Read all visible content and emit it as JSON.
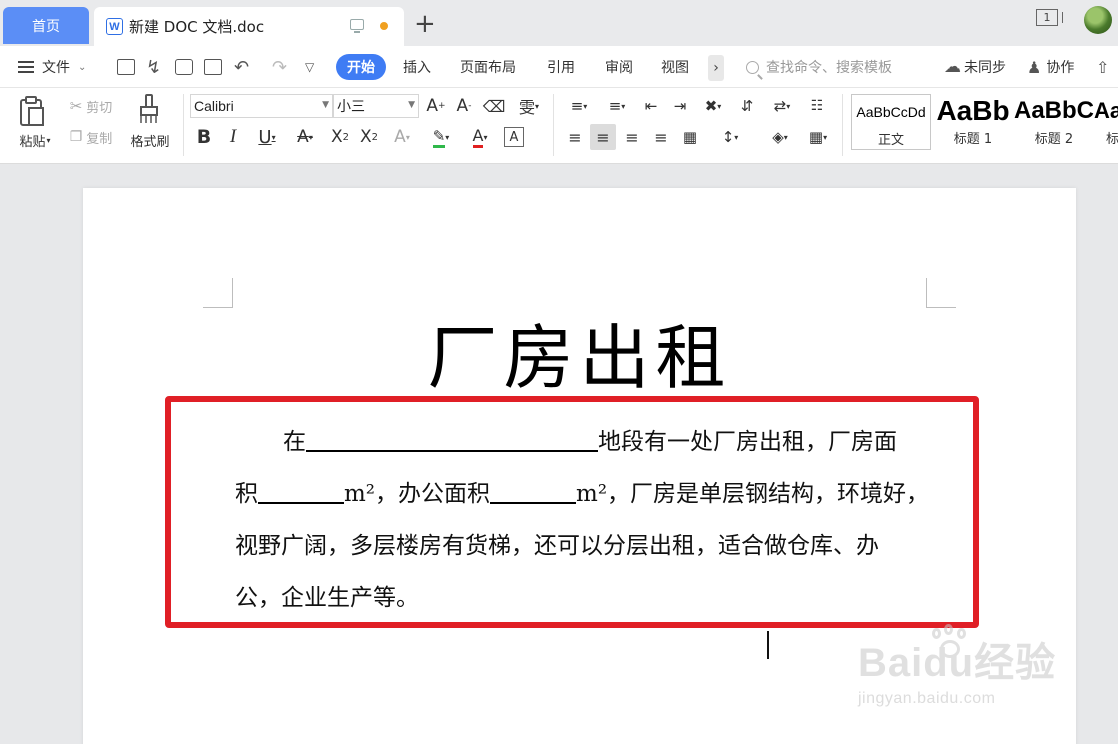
{
  "tabs": {
    "home_label": "首页",
    "doc_title": "新建 DOC 文档.doc",
    "window_count": "1"
  },
  "menu": {
    "file_label": "文件",
    "start_label": "开始",
    "items": [
      "插入",
      "页面布局",
      "引用",
      "审阅",
      "视图"
    ],
    "search_placeholder": "查找命令、搜索模板",
    "sync_label": "未同步",
    "collab_label": "协作"
  },
  "ribbon": {
    "paste_label": "粘贴",
    "cut_label": "剪切",
    "copy_label": "复制",
    "format_painter_label": "格式刷",
    "font_name": "Calibri",
    "font_size": "小三",
    "styles": [
      {
        "preview": "AaBbCcDd",
        "label": "正文"
      },
      {
        "preview": "AaBb",
        "label": "标题 1"
      },
      {
        "preview": "AaBbC",
        "label": "标题 2"
      },
      {
        "preview": "Aa",
        "label": "标"
      }
    ]
  },
  "document": {
    "title": "厂房出租",
    "line1_start": "在",
    "line1_end": "地段有一处厂房出租，厂房面",
    "line2_a": "积",
    "line2_b": "m²，办公面积",
    "line2_c": "m²，厂房是单层钢结构，环境好，",
    "line3": "视野广阔，多层楼房有货梯，还可以分层出租，适合做仓库、办",
    "line4": "公，企业生产等。"
  },
  "watermark": {
    "logo": "Baidu经验",
    "url": "jingyan.baidu.com"
  },
  "colors": {
    "accent": "#3f7cf4",
    "home_tab": "#5b8ef6",
    "highlight": "#e01f26"
  }
}
